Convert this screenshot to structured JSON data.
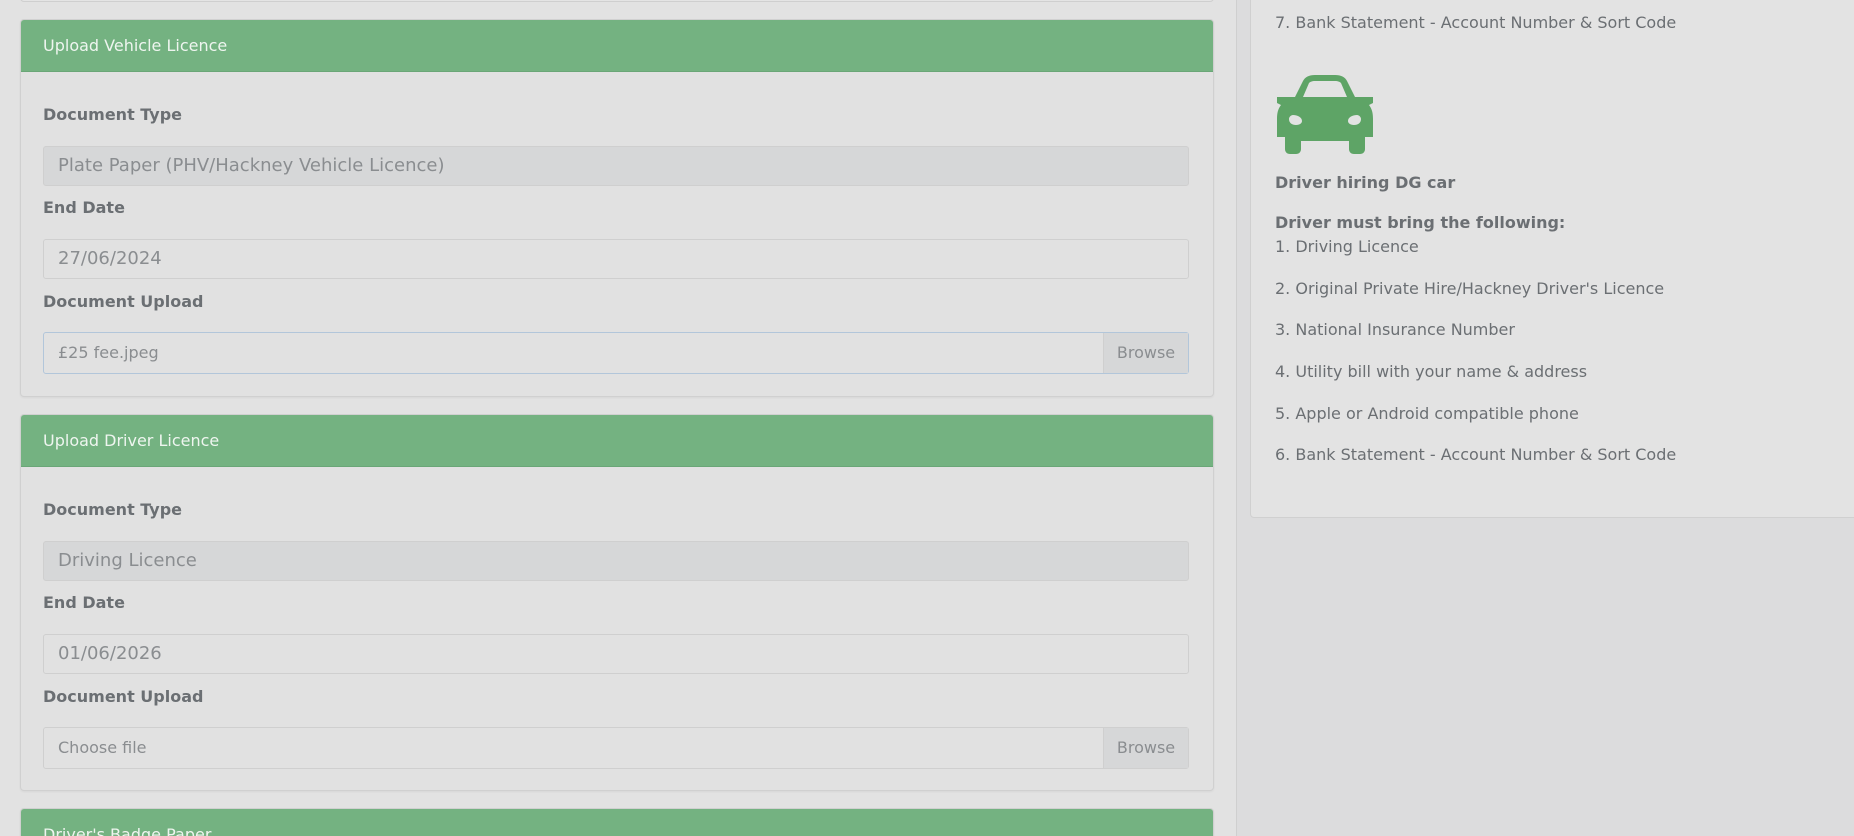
{
  "forms": {
    "vehicle": {
      "header": "Upload Vehicle Licence",
      "doc_type_label": "Document Type",
      "doc_type_value": "Plate Paper (PHV/Hackney Vehicle Licence)",
      "end_date_label": "End Date",
      "end_date_value": "27/06/2024",
      "upload_label": "Document Upload",
      "file_name": "£25 fee.jpeg",
      "browse_label": "Browse"
    },
    "driver": {
      "header": "Upload Driver Licence",
      "doc_type_label": "Document Type",
      "doc_type_value": "Driving Licence",
      "end_date_label": "End Date",
      "end_date_value": "01/06/2026",
      "upload_label": "Document Upload",
      "file_placeholder": "Choose file",
      "browse_label": "Browse"
    },
    "badge": {
      "header": "Driver's Badge Paper"
    }
  },
  "sidebar": {
    "prev_item_7": "7. Bank Statement - Account Number & Sort Code",
    "icon": "car-icon",
    "icon_color": "#5ea466",
    "section_title": "Driver hiring DG car",
    "requirements_title": "Driver must bring the following:",
    "requirements": [
      "1. Driving Licence",
      "2. Original Private Hire/Hackney Driver's Licence",
      "3. National Insurance Number",
      "4. Utility bill with your name & address",
      "5. Apple or Android compatible phone",
      "6. Bank Statement - Account Number & Sort Code"
    ]
  },
  "colors": {
    "card_header": "#74b281",
    "page_background": "#dcdcdd"
  }
}
